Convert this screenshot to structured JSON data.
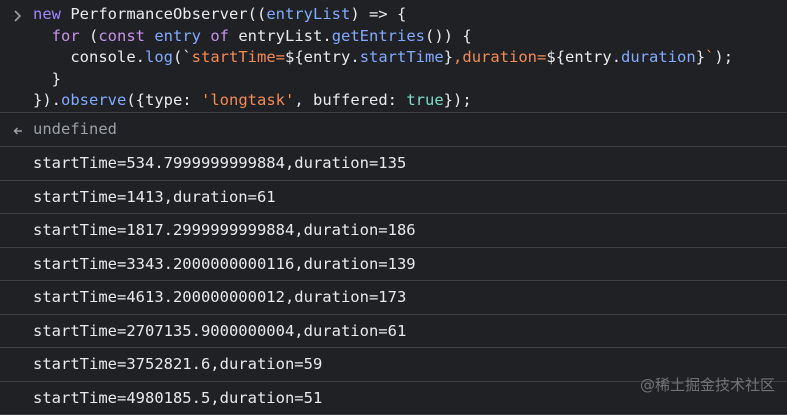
{
  "console": {
    "input": {
      "lines": [
        [
          {
            "t": "new ",
            "c": "kw2"
          },
          {
            "t": "PerformanceObserver",
            "c": "prop"
          },
          {
            "t": "((",
            "c": "punc"
          },
          {
            "t": "entryList",
            "c": "var"
          },
          {
            "t": ") => {",
            "c": "punc"
          }
        ],
        [
          {
            "t": "  ",
            "c": "punc"
          },
          {
            "t": "for ",
            "c": "kw"
          },
          {
            "t": "(",
            "c": "punc"
          },
          {
            "t": "const ",
            "c": "kw"
          },
          {
            "t": "entry ",
            "c": "var"
          },
          {
            "t": "of ",
            "c": "kw"
          },
          {
            "t": "entryList",
            "c": "prop"
          },
          {
            "t": ".",
            "c": "punc"
          },
          {
            "t": "getEntries",
            "c": "fn"
          },
          {
            "t": "()) {",
            "c": "punc"
          }
        ],
        [
          {
            "t": "    console",
            "c": "prop"
          },
          {
            "t": ".",
            "c": "punc"
          },
          {
            "t": "log",
            "c": "fn"
          },
          {
            "t": "(`",
            "c": "punc"
          },
          {
            "t": "startTime=",
            "c": "str"
          },
          {
            "t": "${",
            "c": "tmpl-expr"
          },
          {
            "t": "entry",
            "c": "prop"
          },
          {
            "t": ".",
            "c": "punc"
          },
          {
            "t": "startTime",
            "c": "tmpl-prop"
          },
          {
            "t": "}",
            "c": "tmpl-expr"
          },
          {
            "t": ",duration=",
            "c": "str"
          },
          {
            "t": "${",
            "c": "tmpl-expr"
          },
          {
            "t": "entry",
            "c": "prop"
          },
          {
            "t": ".",
            "c": "punc"
          },
          {
            "t": "duration",
            "c": "tmpl-prop"
          },
          {
            "t": "}",
            "c": "tmpl-expr"
          },
          {
            "t": "`",
            "c": "str"
          },
          {
            "t": ");",
            "c": "punc"
          }
        ],
        [
          {
            "t": "  }",
            "c": "punc"
          }
        ],
        [
          {
            "t": "}).",
            "c": "punc"
          },
          {
            "t": "observe",
            "c": "fn"
          },
          {
            "t": "({",
            "c": "punc"
          },
          {
            "t": "type",
            "c": "prop"
          },
          {
            "t": ": ",
            "c": "punc"
          },
          {
            "t": "'longtask'",
            "c": "strq"
          },
          {
            "t": ", ",
            "c": "punc"
          },
          {
            "t": "buffered",
            "c": "prop"
          },
          {
            "t": ": ",
            "c": "punc"
          },
          {
            "t": "true",
            "c": "bool"
          },
          {
            "t": "});",
            "c": "punc"
          }
        ]
      ]
    },
    "result": "undefined",
    "logs": [
      "startTime=534.7999999999884,duration=135",
      "startTime=1413,duration=61",
      "startTime=1817.2999999999884,duration=186",
      "startTime=3343.2000000000116,duration=139",
      "startTime=4613.200000000012,duration=173",
      "startTime=2707135.9000000004,duration=61",
      "startTime=3752821.6,duration=59",
      "startTime=4980185.5,duration=51"
    ]
  },
  "watermark": "@稀土掘金技术社区",
  "icons": {
    "prompt": "chevron-right-icon",
    "result": "return-arrow-icon"
  },
  "colors": {
    "background": "#202124",
    "divider": "#3c4043",
    "text": "#e8eaed",
    "muted": "#9aa0a6",
    "keyword": "#c792ea",
    "function": "#82aaff",
    "string": "#f28b54",
    "boolean": "#7fdbca"
  }
}
